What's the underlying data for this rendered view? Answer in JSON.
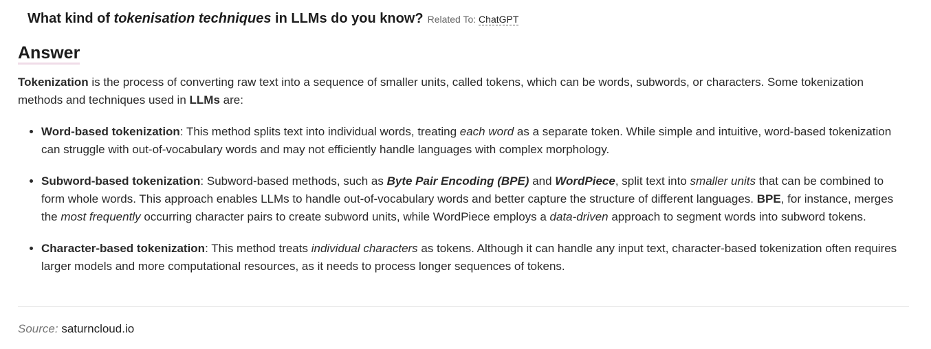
{
  "question": {
    "part1": "What kind of ",
    "emphasis": "tokenisation techniques",
    "part2": " in LLMs do you know?",
    "related_label": "Related To:",
    "related_link": "ChatGPT"
  },
  "answer_heading": "Answer",
  "intro": {
    "term": "Tokenization",
    "text1": " is the process of converting raw text into a sequence of smaller units, called tokens, which can be words, subwords, or characters. Some tokenization methods and techniques used in ",
    "llms": "LLMs",
    "text2": " are:"
  },
  "items": [
    {
      "title": "Word-based tokenization",
      "t1": ": This method splits text into individual words, treating ",
      "em1": "each word",
      "t2": " as a separate token. While simple and intuitive, word-based tokenization can struggle with out-of-vocabulary words and may not efficiently handle languages with complex morphology."
    },
    {
      "title": "Subword-based tokenization",
      "t1": ": Subword-based methods, such as ",
      "bi1": "Byte Pair Encoding (BPE)",
      "t2": " and ",
      "bi2": "WordPiece",
      "t3": ", split text into ",
      "em1": "smaller units",
      "t4": " that can be combined to form whole words. This approach enables LLMs to handle out-of-vocabulary words and better capture the structure of different languages. ",
      "b1": "BPE",
      "t5": ", for instance, merges the ",
      "em2": "most frequently",
      "t6": " occurring character pairs to create subword units, while WordPiece employs a ",
      "em3": "data-driven",
      "t7": " approach to segment words into subword tokens."
    },
    {
      "title": "Character-based tokenization",
      "t1": ": This method treats ",
      "em1": "individual characters",
      "t2": " as tokens. Although it can handle any input text, character-based tokenization often requires larger models and more computational resources, as it needs to process longer sequences of tokens."
    }
  ],
  "source": {
    "label": "Source:",
    "value": "saturncloud.io"
  }
}
